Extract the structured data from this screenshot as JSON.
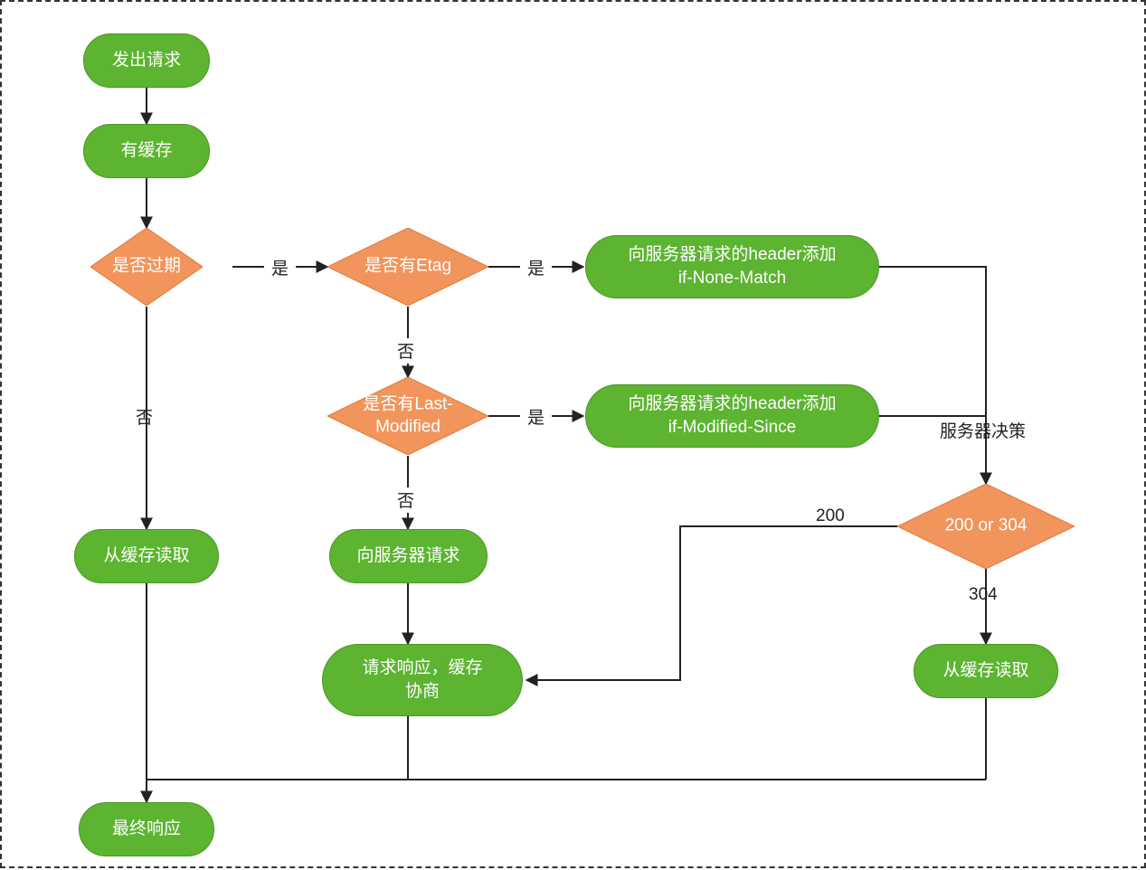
{
  "nodes": {
    "start": {
      "text": "发出请求"
    },
    "has_cache": {
      "text": "有缓存"
    },
    "expired": {
      "text": "是否过期"
    },
    "has_etag": {
      "text": "是否有Etag"
    },
    "has_lm": {
      "text": "是否有Last-\nModified"
    },
    "add_inm": {
      "text": "向服务器请求的header添加\nif-None-Match"
    },
    "add_ims": {
      "text": "向服务器请求的header添加\nif-Modified-Since"
    },
    "read_cache1": {
      "text": "从缓存读取"
    },
    "req_server": {
      "text": "向服务器请求"
    },
    "resp_nego": {
      "text": "请求响应，缓存\n协商"
    },
    "decide": {
      "text": "200 or 304"
    },
    "read_cache2": {
      "text": "从缓存读取"
    },
    "final": {
      "text": "最终响应"
    }
  },
  "labels": {
    "yes1": "是",
    "yes2": "是",
    "yes3": "是",
    "no1": "否",
    "no2": "否",
    "no3": "否",
    "policy": "服务器决策",
    "r200": "200",
    "r304": "304"
  }
}
